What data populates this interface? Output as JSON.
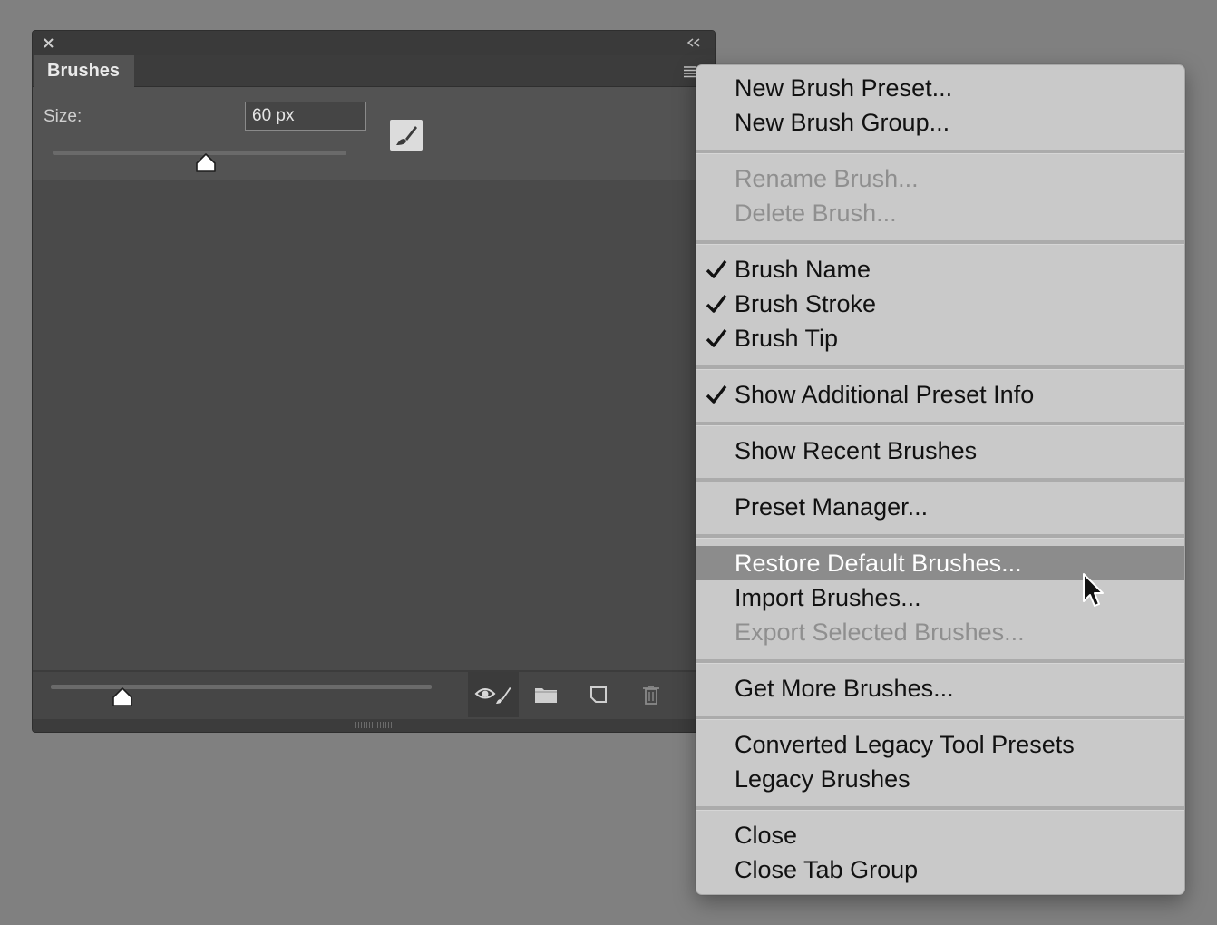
{
  "panel": {
    "tab_label": "Brushes",
    "size_label": "Size:",
    "size_value": "60 px",
    "size_slider_position": 0.52,
    "preview_slider_position": 0.18
  },
  "menu": {
    "items": [
      {
        "label": "New Brush Preset...",
        "enabled": true,
        "checked": false
      },
      {
        "label": "New Brush Group...",
        "enabled": true,
        "checked": false
      },
      {
        "label": "Rename Brush...",
        "enabled": false,
        "checked": false
      },
      {
        "label": "Delete Brush...",
        "enabled": false,
        "checked": false
      },
      {
        "label": "Brush Name",
        "enabled": true,
        "checked": true
      },
      {
        "label": "Brush Stroke",
        "enabled": true,
        "checked": true
      },
      {
        "label": "Brush Tip",
        "enabled": true,
        "checked": true
      },
      {
        "label": "Show Additional Preset Info",
        "enabled": true,
        "checked": true
      },
      {
        "label": "Show Recent Brushes",
        "enabled": true,
        "checked": false
      },
      {
        "label": "Preset Manager...",
        "enabled": true,
        "checked": false
      },
      {
        "label": "Restore Default Brushes...",
        "enabled": true,
        "checked": false,
        "highlighted": true
      },
      {
        "label": "Import Brushes...",
        "enabled": true,
        "checked": false
      },
      {
        "label": "Export Selected Brushes...",
        "enabled": false,
        "checked": false
      },
      {
        "label": "Get More Brushes...",
        "enabled": true,
        "checked": false
      },
      {
        "label": "Converted Legacy Tool Presets",
        "enabled": true,
        "checked": false
      },
      {
        "label": "Legacy Brushes",
        "enabled": true,
        "checked": false
      },
      {
        "label": "Close",
        "enabled": true,
        "checked": false
      },
      {
        "label": "Close Tab Group",
        "enabled": true,
        "checked": false
      }
    ]
  },
  "colors": {
    "menu_bg": "#c9c9c9",
    "highlight_bg": "#8c8c8c",
    "disabled_text": "#8f8f8f",
    "panel_bg": "#4a4a4a"
  }
}
